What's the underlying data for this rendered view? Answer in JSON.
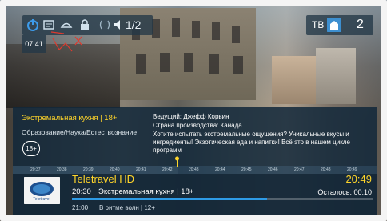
{
  "top_bar": {
    "clock": "07:41",
    "audio_label": "1/2",
    "icons": [
      "power-icon",
      "subtitles-icon",
      "lock-icon",
      "signal-icon",
      "speaker-icon"
    ]
  },
  "top_right": {
    "source": "ТВ",
    "channel_number": "2",
    "icon": "source-input-icon"
  },
  "info": {
    "show_title": "Экстремальная кухня | 18+",
    "genre": "Образование/Наука/Естествознание",
    "age_rating": "18+",
    "host": "Ведущий: Джефф Корвин",
    "country": "Страна производства: Канада",
    "description": "Хотите испытать экстремальные ощущения? Уникальные вкусы и ингредиенты! Экзотическая еда и напитки! Всё это в нашем цикле программ"
  },
  "timeline": {
    "ticks": [
      "20:37",
      "20:38",
      "20:39",
      "20:40",
      "20:41",
      "20:42",
      "20:43",
      "20:44",
      "20:45",
      "20:46",
      "20:47",
      "20:48",
      "20:49"
    ]
  },
  "bottom": {
    "channel_name": "Teletravel HD",
    "clock": "20:49",
    "now_time": "20:30",
    "now_title": "Экстремальная кухня | 18+",
    "remaining": "Осталось: 00:10",
    "progress": 0.65,
    "next_time": "21:00",
    "next_title": "В ритме волн | 12+",
    "logo_text": "Teletravel"
  },
  "colors": {
    "accent_yellow": "#ffd52a",
    "progress_blue": "#2e9be6"
  }
}
